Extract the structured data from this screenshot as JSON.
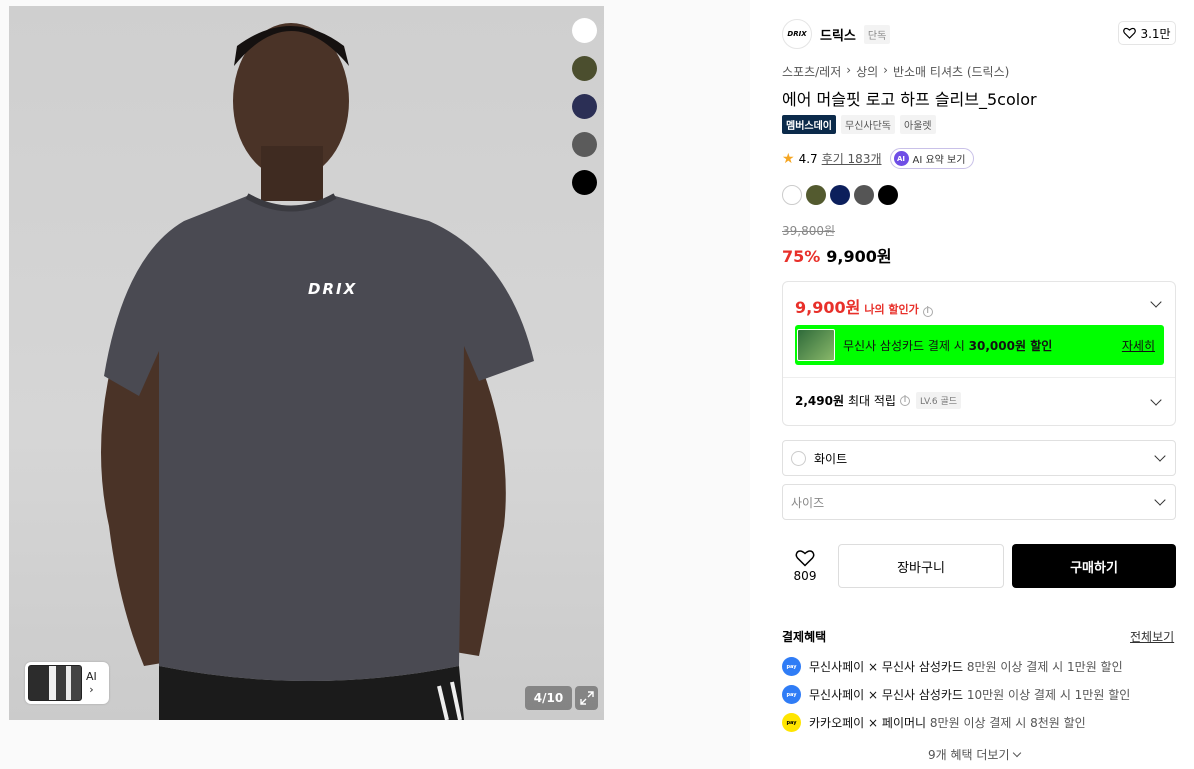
{
  "gallery": {
    "image_counter": "4/10",
    "thumb_ai_label": "AI",
    "shirt_print": "DRIX",
    "swatches": [
      "#ffffff",
      "#4b4e2e",
      "#2b2f55",
      "#5b5b5b",
      "#000000"
    ]
  },
  "brand": {
    "logo_text": "DRIX",
    "name": "드릭스",
    "exclusive_badge": "단독",
    "like_count": "3.1만"
  },
  "breadcrumb": [
    "스포츠/레저",
    "상의",
    "반소매 티셔츠 (드릭스)"
  ],
  "product": {
    "title": "에어 머슬핏 로고 하프 슬리브_5color",
    "tags": [
      "멤버스데이",
      "무신사단독",
      "아울렛"
    ],
    "rating": "4.7",
    "reviews": "후기 183개",
    "ai_summary": "AI 요약 보기",
    "ai_icon": "AI",
    "colors": [
      "#ffffff",
      "#535a2f",
      "#0c1f5c",
      "#555555",
      "#000000"
    ],
    "original_price": "39,800원",
    "discount_rate": "75%",
    "final_price": "9,900원"
  },
  "benefit": {
    "my_price": "9,900원",
    "my_price_label": "나의 할인가",
    "card_banner_prefix": "무신사 삼성카드 결제 시 ",
    "card_banner_bold": "30,000원 할인",
    "card_banner_link": "자세히",
    "points_amount": "2,490원",
    "points_label": "최대 적립",
    "level_badge": "LV.6 골드"
  },
  "options": {
    "color_selected": "화이트",
    "size_placeholder": "사이즈"
  },
  "actions": {
    "like_count": "809",
    "cart_label": "장바구니",
    "buy_label": "구매하기"
  },
  "payment": {
    "title": "결제혜택",
    "view_all": "전체보기",
    "items": [
      {
        "provider": "무신사페이",
        "x": "×",
        "partner": "무신사 삼성카드",
        "desc": "8만원 이상 결제 시 1만원 할인",
        "icon_color": "#2f7cf6"
      },
      {
        "provider": "무신사페이",
        "x": "×",
        "partner": "무신사 삼성카드",
        "desc": "10만원 이상 결제 시 1만원 할인",
        "icon_color": "#2f7cf6"
      },
      {
        "provider": "카카오페이",
        "x": "×",
        "partner": "페이머니",
        "desc": "8만원 이상 결제 시 8천원 할인",
        "icon_color": "#ffe500"
      }
    ],
    "more": "9개 혜택 더보기"
  }
}
